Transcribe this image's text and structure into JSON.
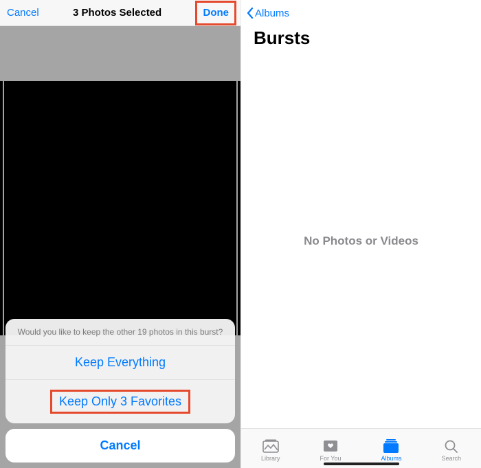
{
  "left": {
    "nav": {
      "cancel": "Cancel",
      "title": "3 Photos Selected",
      "done": "Done"
    },
    "sheet": {
      "prompt": "Would you like to keep the other 19 photos in this burst?",
      "keep_everything": "Keep Everything",
      "keep_favorites": "Keep Only 3 Favorites",
      "cancel": "Cancel"
    }
  },
  "right": {
    "back_label": "Albums",
    "title": "Bursts",
    "empty_message": "No Photos or Videos",
    "tabs": {
      "library": "Library",
      "for_you": "For You",
      "albums": "Albums",
      "search": "Search"
    }
  },
  "colors": {
    "ios_blue": "#007aff",
    "highlight": "#e64a2e"
  }
}
